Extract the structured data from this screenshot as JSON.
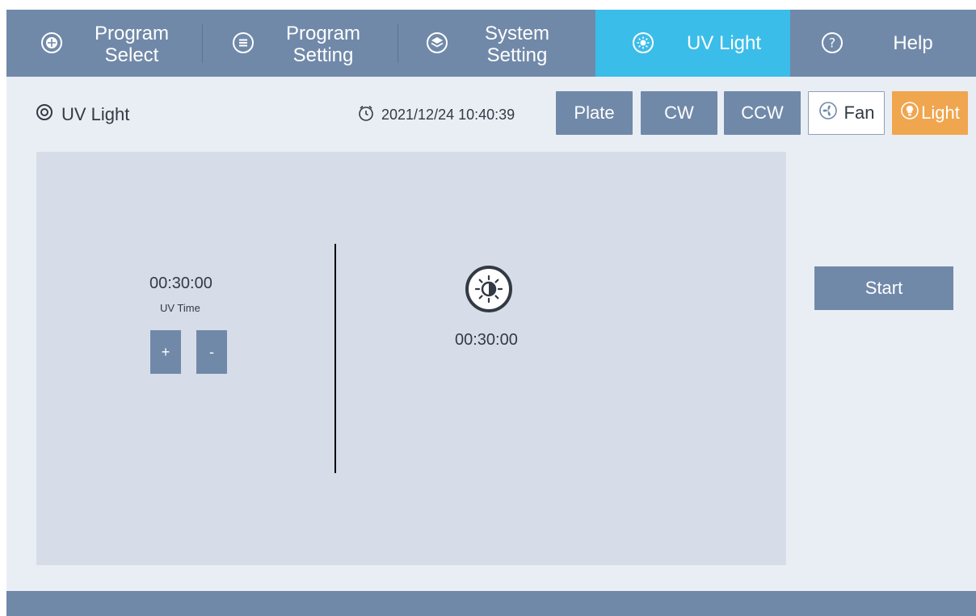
{
  "colors": {
    "nav_bg": "#7189a9",
    "nav_active": "#3bbde9",
    "page_bg": "#e9eef5",
    "panel_bg": "#d6dde8",
    "light_button": "#f0a64f"
  },
  "nav": {
    "tabs": [
      {
        "label": "Program Select",
        "line1": "Program",
        "line2": "Select",
        "icon": "program-select-icon",
        "active": false
      },
      {
        "label": "Program Setting",
        "line1": "Program",
        "line2": "Setting",
        "icon": "program-setting-icon",
        "active": false
      },
      {
        "label": "System Setting",
        "line1": "System",
        "line2": "Setting",
        "icon": "system-setting-icon",
        "active": false
      },
      {
        "label": "UV Light",
        "icon": "uv-light-icon",
        "active": true
      },
      {
        "label": "Help",
        "icon": "help-icon",
        "active": false
      }
    ]
  },
  "header": {
    "title": "UV Light",
    "datetime": "2021/12/24 10:40:39"
  },
  "toolbar": {
    "plate": "Plate",
    "cw": "CW",
    "ccw": "CCW",
    "fan": "Fan",
    "light": "Light"
  },
  "uv": {
    "set_time": "00:30:00",
    "time_label": "UV Time",
    "plus": "+",
    "minus": "-",
    "remaining": "00:30:00"
  },
  "actions": {
    "start": "Start"
  }
}
